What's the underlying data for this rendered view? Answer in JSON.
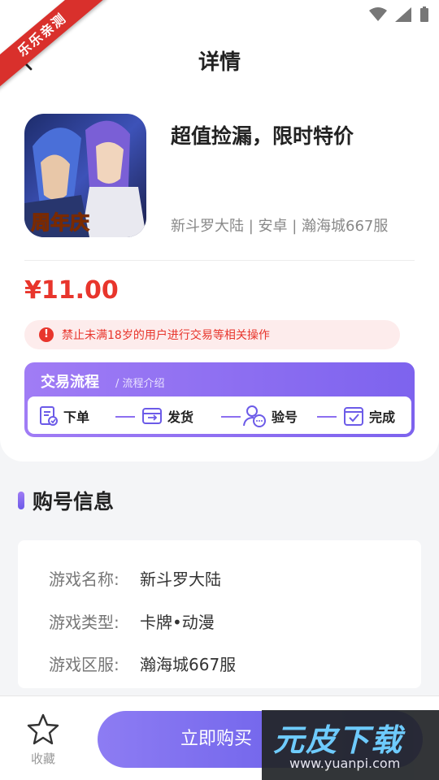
{
  "ribbon": "乐乐亲测",
  "header": {
    "title": "详情"
  },
  "game": {
    "title": "超值捡漏，限时特价",
    "meta": "新斗罗大陆 | 安卓 | 瀚海城667服",
    "cover_badge": "周年庆"
  },
  "price": "¥11.00",
  "warning": {
    "icon": "!",
    "text": "禁止未满18岁的用户进行交易等相关操作"
  },
  "process": {
    "title": "交易流程",
    "link": "/ 流程介绍",
    "steps": [
      {
        "label": "下单",
        "icon": "order-icon"
      },
      {
        "label": "发货",
        "icon": "ship-icon"
      },
      {
        "label": "验号",
        "icon": "verify-account-icon"
      },
      {
        "label": "完成",
        "icon": "done-icon"
      }
    ]
  },
  "section": {
    "title": "购号信息"
  },
  "info": [
    {
      "key": "游戏名称:",
      "value": "新斗罗大陆"
    },
    {
      "key": "游戏类型:",
      "value": "卡牌•动漫"
    },
    {
      "key": "游戏区服:",
      "value": "瀚海城667服"
    }
  ],
  "bottom": {
    "fav_label": "收藏",
    "buy_label": "立即购买"
  },
  "watermark": {
    "main": "元皮下载",
    "sub": "www.yuanpi.com"
  },
  "colors": {
    "accent": "#7d63ee",
    "price": "#e8352c"
  }
}
